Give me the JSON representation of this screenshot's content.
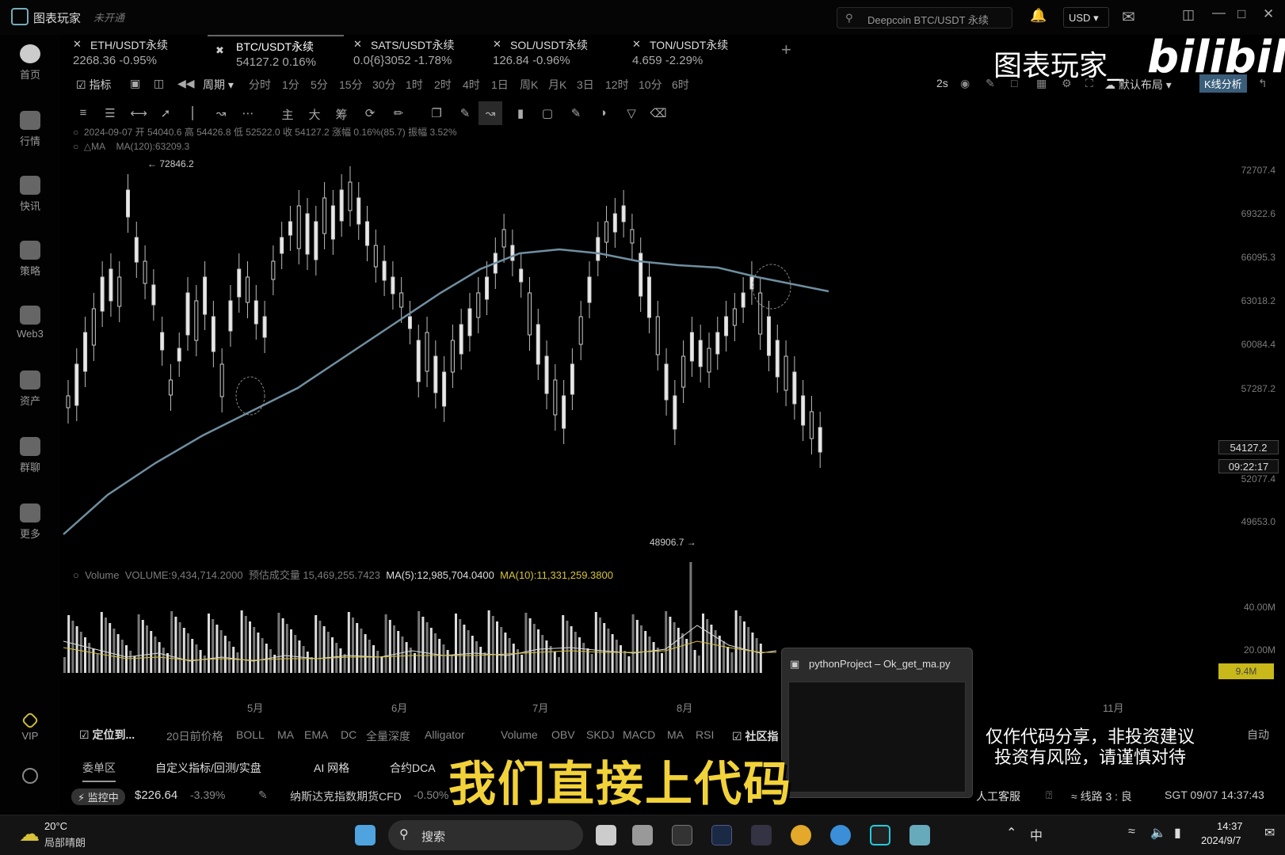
{
  "app": {
    "title": "图表玩家",
    "vip_status": "未开通"
  },
  "header": {
    "search_placeholder": "Deepcoin BTC/USDT 永续",
    "currency": "USD",
    "icons": [
      "bell-icon",
      "mail-icon",
      "sidebar-toggle-icon",
      "minimize-icon",
      "maximize-icon",
      "close-icon"
    ]
  },
  "sidebar": {
    "items": [
      {
        "label": "首页",
        "icon": "home-icon"
      },
      {
        "label": "行情",
        "icon": "market-icon"
      },
      {
        "label": "快讯",
        "icon": "news-icon"
      },
      {
        "label": "策略",
        "icon": "strategy-icon"
      },
      {
        "label": "Web3",
        "icon": "web3-icon"
      },
      {
        "label": "资产",
        "icon": "wallet-icon"
      },
      {
        "label": "群聊",
        "icon": "chat-icon"
      },
      {
        "label": "更多",
        "icon": "more-icon"
      },
      {
        "label": "VIP",
        "icon": "vip-icon"
      }
    ]
  },
  "tabs": [
    {
      "name": "ETH/USDT永续",
      "price": "2268.36",
      "change": "-0.95%"
    },
    {
      "name": "BTC/USDT永续",
      "price": "54127.2",
      "change": "0.16%"
    },
    {
      "name": "SATS/USDT永续",
      "price": "0.0{6}3052",
      "change": "-1.78%"
    },
    {
      "name": "SOL/USDT永续",
      "price": "126.84",
      "change": "-0.96%"
    },
    {
      "name": "TON/USDT永续",
      "price": "4.659",
      "change": "-2.29%"
    }
  ],
  "periods": {
    "indicators": "指标",
    "cycle": "周期",
    "items": [
      "分时",
      "1分",
      "5分",
      "15分",
      "30分",
      "1时",
      "2时",
      "4时",
      "1日",
      "周K",
      "月K",
      "3日",
      "12时",
      "10分",
      "6时"
    ],
    "refresh": "2s",
    "layout": "默认布局",
    "analysis": "K线分析"
  },
  "toolbar": {
    "text_tools": [
      "主",
      "大",
      "筹"
    ]
  },
  "ohlc": {
    "date": "2024-09-07",
    "open_label": "开",
    "open": "54040.6",
    "high_label": "高",
    "high": "54426.8",
    "low_label": "低",
    "low": "52522.0",
    "close_label": "收",
    "close": "54127.2",
    "change_label": "涨幅",
    "change": "0.16%(85.7)",
    "amplitude_label": "振幅",
    "amplitude": "3.52%"
  },
  "ma_line": {
    "label": "MA",
    "value": "MA(120):63209.3"
  },
  "chart_data": {
    "type": "candlestick",
    "y_axis": [
      "72707.4",
      "69322.6",
      "66095.3",
      "63018.2",
      "60084.4",
      "57287.2",
      "52077.4",
      "49653.0"
    ],
    "x_axis": [
      "5月",
      "6月",
      "7月",
      "8月",
      "11月"
    ],
    "annotations": {
      "high": "72846.2",
      "low": "48906.7"
    },
    "current_price": "54127.2",
    "countdown": "09:22:17",
    "ma120_color": "#6f8fa0"
  },
  "volume": {
    "label": "Volume",
    "volume": "VOLUME:9,434,714.2000",
    "est": "预估成交量 15,469,255.7423",
    "ma5": "MA(5):12,985,704.0400",
    "ma10": "MA(10):11,331,259.3800",
    "y_axis": [
      "40.00M",
      "20.00M"
    ],
    "tag": "9.4M"
  },
  "bottom_indicators": {
    "locate": "定位到...",
    "items": [
      "20日前价格",
      "BOLL",
      "MA",
      "EMA",
      "DC",
      "全量深度",
      "Alligator"
    ],
    "sub_items": [
      "Volume",
      "OBV",
      "SKDJ",
      "MACD",
      "MA",
      "RSI"
    ],
    "community": "社区指",
    "auto": "自动"
  },
  "bottom_tabs": [
    "委单区",
    "自定义指标/回测/实盘",
    "AI 网格",
    "合约DCA"
  ],
  "status": {
    "monitor": "监控中",
    "price": "$226.64",
    "change": "-3.39%",
    "ticker": "纳斯达克指数期货CFD",
    "ticker_change": "-0.50%",
    "service": "人工客服",
    "line": "线路 3 : 良",
    "time": "SGT 09/07 14:37:43"
  },
  "python_window": {
    "title": "pythonProject – Ok_get_ma.py"
  },
  "overlay": {
    "subtitle": "我们直接上代码",
    "disclaimer_1": "仅作代码分享，非投资建议",
    "disclaimer_2": "投资有风险，请谨慎对待",
    "watermark": "图表玩家_",
    "platform": "bilibili"
  },
  "taskbar": {
    "weather_temp": "20°C",
    "weather_desc": "局部晴朗",
    "search": "搜索",
    "ime": "中",
    "clock_time": "14:37",
    "clock_date": "2024/9/7"
  }
}
